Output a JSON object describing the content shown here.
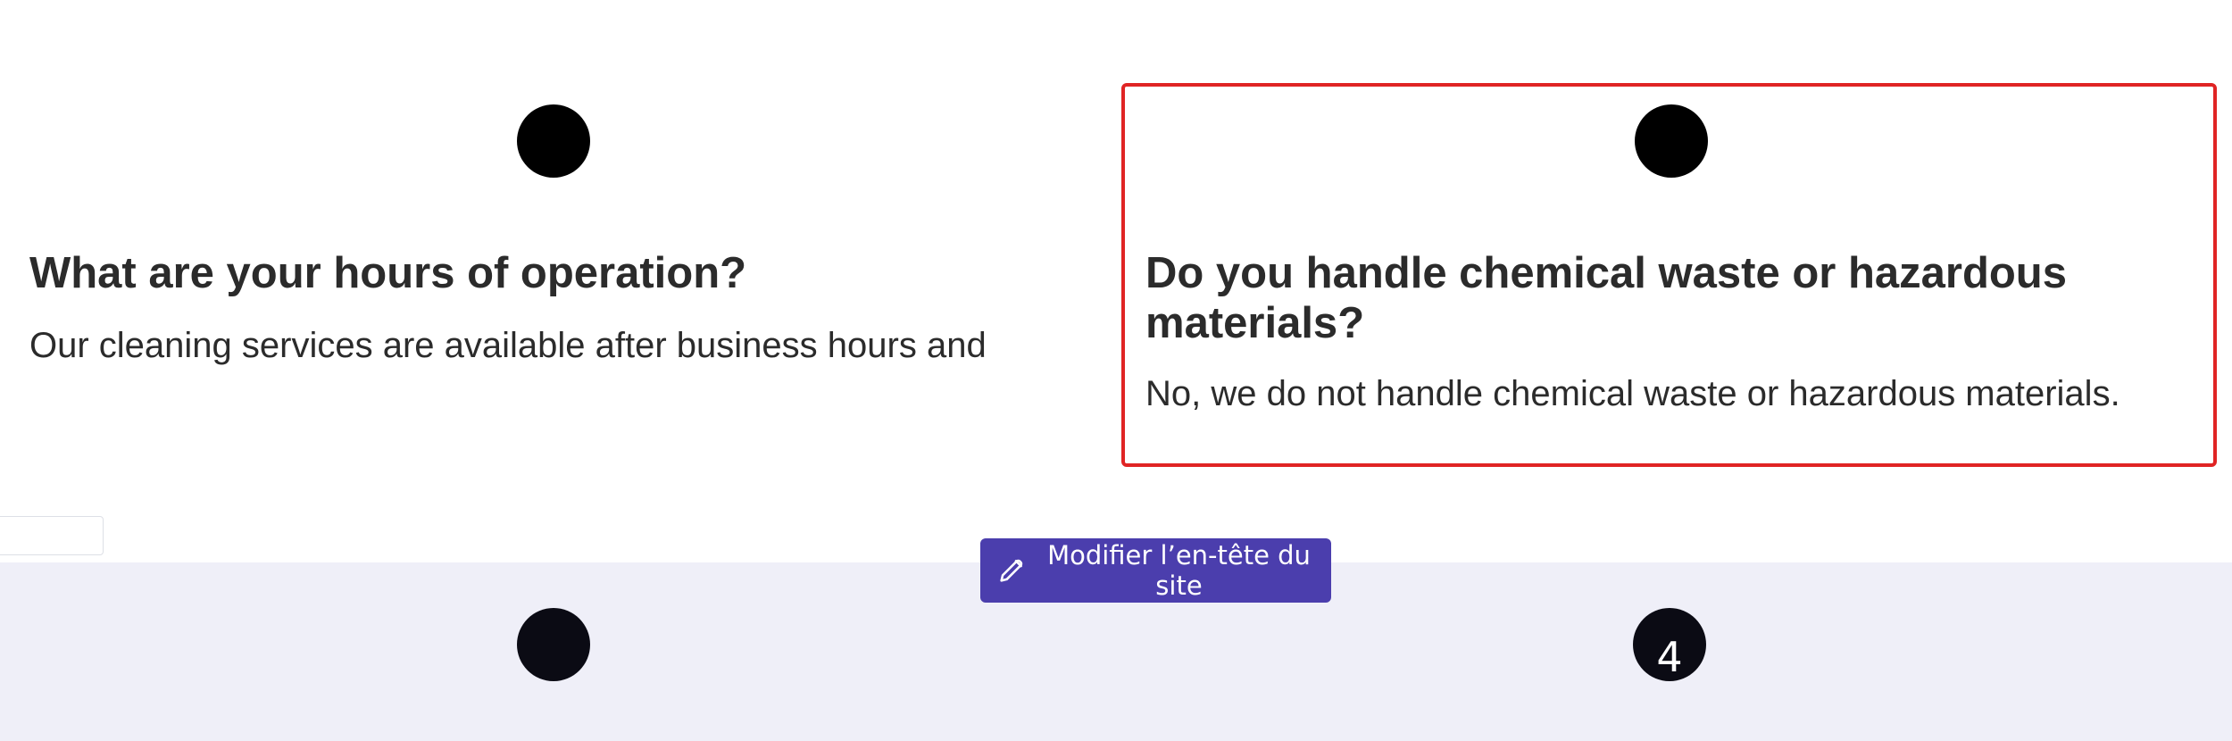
{
  "faq": {
    "items": [
      {
        "question": "What are your hours of operation?",
        "answer": "Our cleaning services are available after business hours and"
      },
      {
        "question": "Do you handle chemical waste or hazardous materials?",
        "answer": "No, we do not handle chemical waste or hazardous materials."
      }
    ]
  },
  "edit_header": {
    "label": "Modifier l’en-tête du site",
    "icon": "pencil-icon"
  },
  "bottom": {
    "items": [
      {
        "number": ""
      },
      {
        "number": "4"
      }
    ]
  },
  "colors": {
    "selection_border": "#e02424",
    "button_background": "#4b3ead",
    "bottom_section_background": "#efeff8",
    "text": "#2b2b2b"
  }
}
